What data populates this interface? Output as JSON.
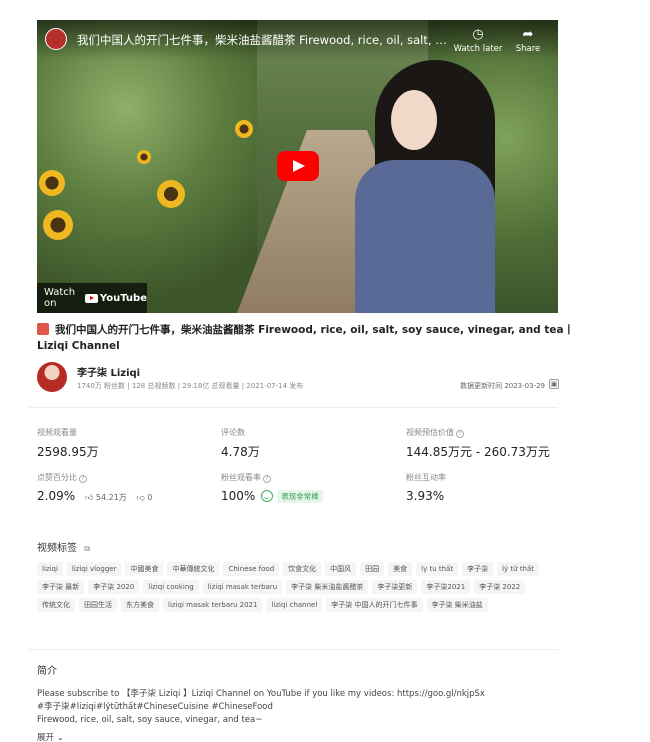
{
  "video": {
    "title": "我们中国人的开门七件事，柴米油盐酱醋茶 Firewood, rice, oil, salt, soy sauce, vinegar, and tea丨Liziqi Channel",
    "watch_later_label": "Watch later",
    "share_label": "Share",
    "watch_on_label": "Watch on",
    "youtube_label": "YouTube"
  },
  "page_title": "我们中国人的开门七件事，柴米油盐酱醋茶 Firewood, rice, oil, salt, soy sauce, vinegar, and tea丨Liziqi Channel",
  "author": {
    "name": "李子柒 Liziqi",
    "fans": "1740万 粉丝数",
    "videos": "128 总视频数",
    "total_views": "29.18亿 总观看量",
    "published": "2021-07-14 发布",
    "update_time": "数据更新时间 2023-03-29"
  },
  "stats": {
    "views_label": "视频观看量",
    "views_value": "2598.95万",
    "comments_label": "评论数",
    "comments_value": "4.78万",
    "value_label": "视频预估价值",
    "value_value": "144.85万元 - 260.73万元",
    "like_rate_label": "点赞百分比",
    "like_rate_value": "2.09%",
    "likes": "54.21万",
    "dislikes": "0",
    "fan_view_label": "粉丝观看率",
    "fan_view_value": "100%",
    "fan_view_badge": "表现非常棒",
    "fan_interact_label": "粉丝互动率",
    "fan_interact_value": "3.93%"
  },
  "tags_title": "视频标签",
  "tags": [
    "liziqi",
    "liziqi vlogger",
    "中國美食",
    "中華傳統文化",
    "Chinese food",
    "饮食文化",
    "中国风",
    "田园",
    "美食",
    "ly tu thất",
    "李子柒",
    "lý tữ thất",
    "李子柒 最新",
    "李子柒 2020",
    "liziqi cooking",
    "liziqi masak terbaru",
    "李子柒 柴米油盐酱醋茶",
    "李子柒更新",
    "李子柒2021",
    "李子柒 2022",
    "传统文化",
    "田园生活",
    "东方美食",
    "liziqi masak terbaru 2021",
    "liziqi channel",
    "李子柒 中国人的开门七件事",
    "李子柒 柴米油盐"
  ],
  "description": {
    "title": "简介",
    "line1": "Please subscribe to 【李子柒 Liziqi 】Liziqi Channel on YouTube if you like my videos: https://goo.gl/nkjpSx",
    "line2": "#李子柒#liziqi#lýtữthất#ChineseCuisine #ChineseFood",
    "line3": "Firewood, rice, oil, salt, soy sauce, vinegar, and tea~",
    "expand_label": "展开"
  },
  "colors": {
    "accent_green": "#3cb35f",
    "youtube_red": "#ff0000",
    "title_badge": "#e1554a"
  }
}
